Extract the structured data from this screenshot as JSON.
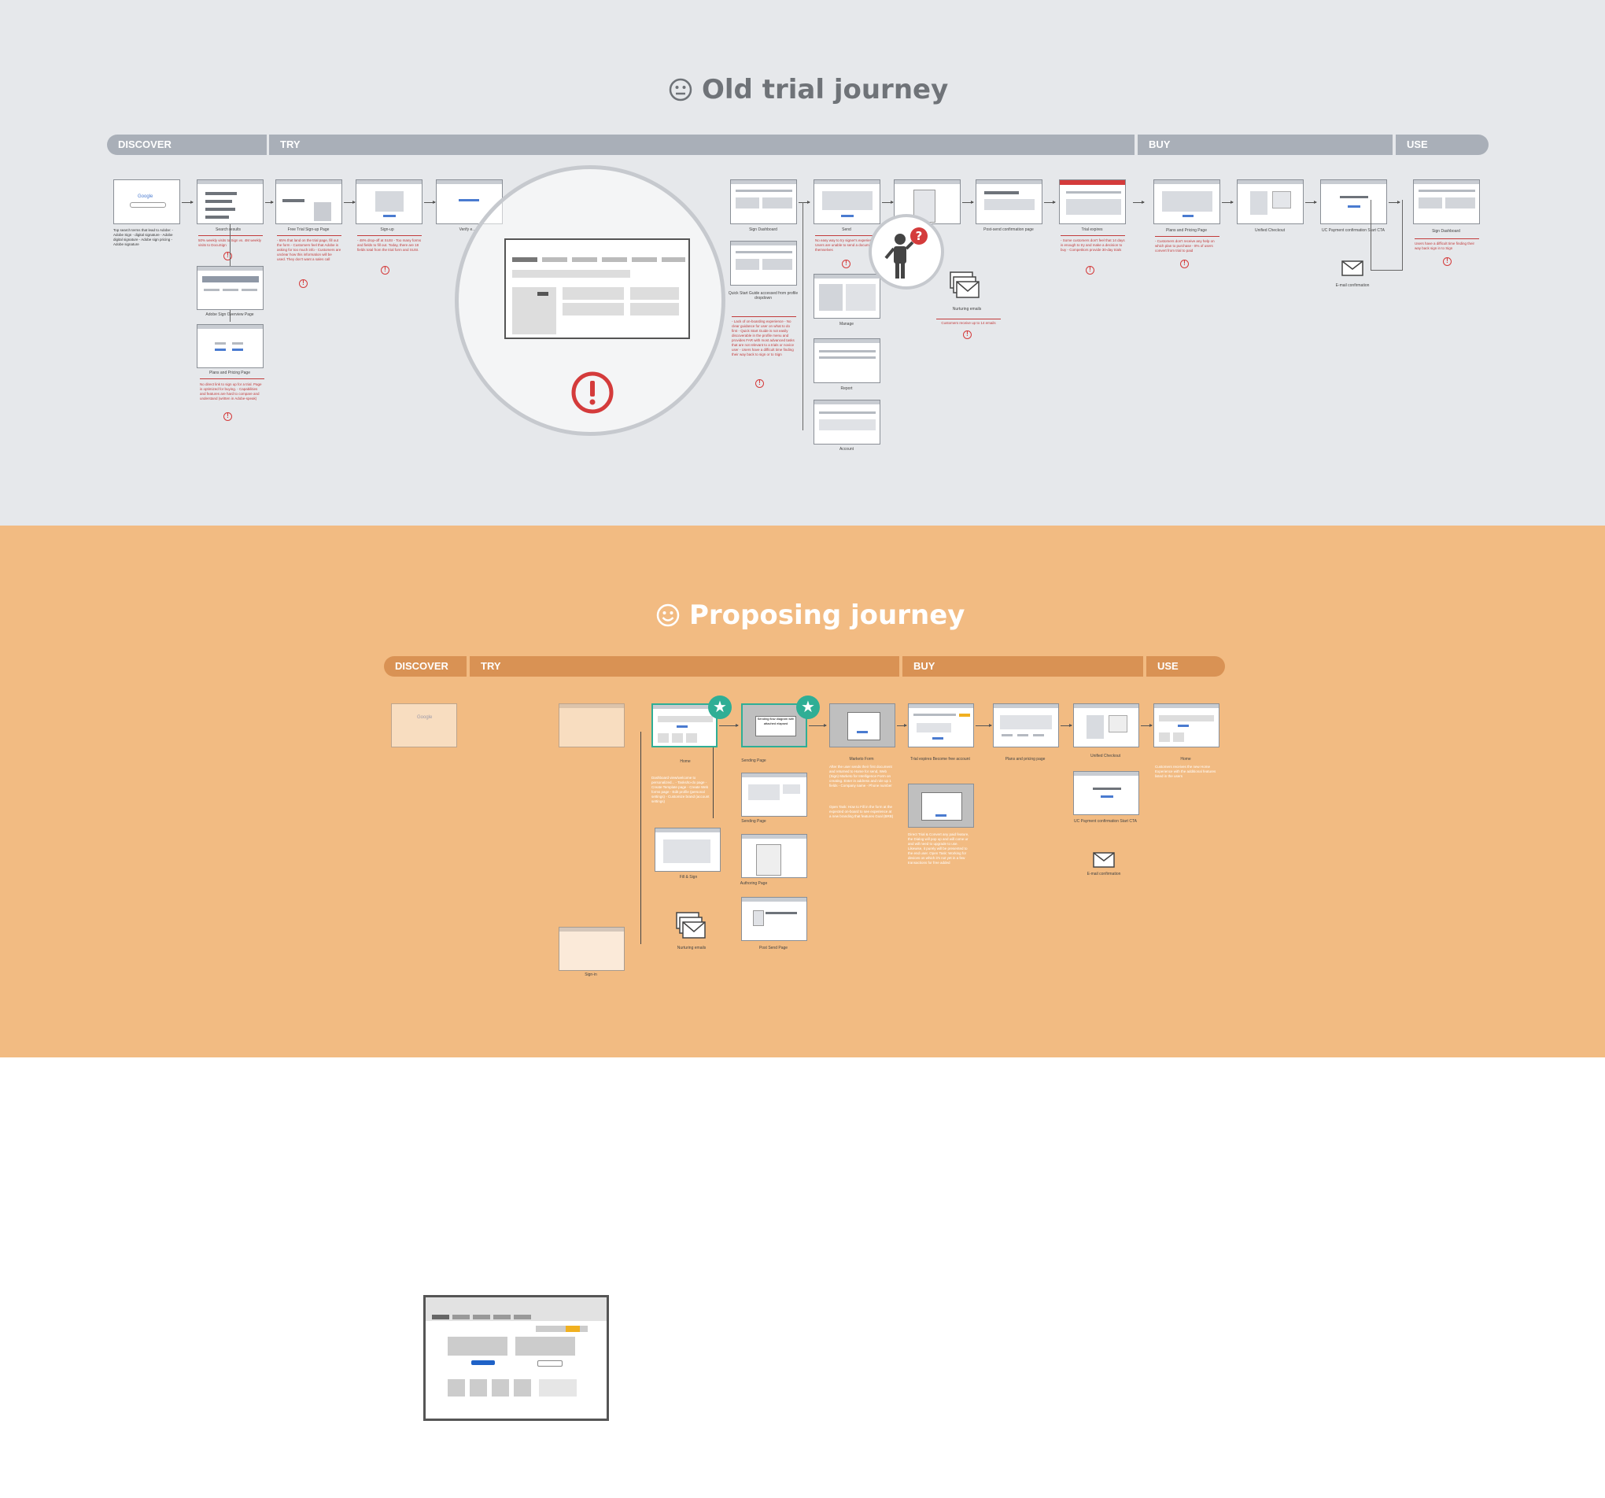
{
  "titles": {
    "old": "Old trial journey",
    "new": "Proposing journey"
  },
  "old_phases": [
    "DISCOVER",
    "TRY",
    "BUY",
    "USE"
  ],
  "new_phases": [
    "DISCOVER",
    "TRY",
    "BUY",
    "USE"
  ],
  "old_journey": {
    "labels": {
      "search": "Search results",
      "free_trial": "Free Trial Sign-up Page",
      "signup": "Sign-up",
      "verify": "Verify e...",
      "sign_dashboard": "Sign Dashboard",
      "send": "Send",
      "post_send": "Post-send confirmation page",
      "trial_expires": "Trial expires",
      "plans": "Plans and Pricing Page",
      "unified_checkout": "Unified Checkout",
      "payment": "UC Payment confirmation Start CTA",
      "dashboard_use": "Sign Dashboard",
      "overview": "Adobe Sign Overview Page",
      "plans_pricing": "Plans and Pricing Page",
      "quick_start": "Quick Start Guide accessed from profile dropdown",
      "manage": "Manage",
      "report": "Report",
      "account": "Account",
      "nurturing": "Nurturing emails",
      "email_confirm": "E-mail confirmation",
      "google": "Google"
    },
    "notes": {
      "search_terms": "Top search terms that lead to Adobe: - Adobe Sign - digital signature - Adobe digital signature - Adobe sign pricing - Adobe signature",
      "search": "50% weekly visits to Sign vs. 4M weekly visits to DocuSign",
      "free_trial": "- 65% that land on the trial page, fill out the form - Customers feel that Adobe is asking for too much info - Customers are unclear how this information will be used. They don't want a sales call",
      "signup": "- 48% drop-off at SUSI - Too many forms and fields to fill out. Today, there are 18 fields total from the trial form and SUSI.",
      "plans": "No direct link to sign up for a trial. Page is optimized for buying. - Capabilities and features are hard to compare and understand (written in Adobe-speak)",
      "quick_start": "- Lack of on-boarding experience - No clear guidance for user on what to do first - Quick Start Guide is not easily discoverable in the profile menu and provides FAR with most advanced tasks that are not relevant to a trials or novice user - Users have a difficult time finding their way back to sign or to Sign",
      "send": "No easy way to try signer's experience. Users are unable to send a document to themselves",
      "nurturing": "Customers receive up to 14 emails",
      "trial_expires": "- Some customers don't feel that 14 days is enough to try and make a decision to buy - Competitors provide 30-day trials",
      "plans_buy": "- Customers don't receive any help on which plan to purchase - 8% of users convert from trial to paid",
      "use": "Users have a difficult time finding their way back sign in to Sign"
    }
  },
  "new_journey": {
    "labels": {
      "home": "Home",
      "sending_page": "Sending Page",
      "sending_page2": "Sending Page",
      "fill_sign": "Fill & Sign",
      "authoring": "Authoring Page",
      "post_send": "Post Send Page",
      "marketo": "Marketo Form",
      "trial_expires": "Trial expires Become free account",
      "plans": "Plans and pricing page",
      "unified_checkout": "Unified Checkout",
      "payment": "UC Payment confirmation Start CTA",
      "email_confirm": "E-mail confirmation",
      "home_use": "Home",
      "nurturing": "Nurturing emails",
      "signin": "Sign-in",
      "sending_dialog": "Sending flow diagram with attached elapsed",
      "google": "Google"
    },
    "notes": {
      "home": "Dashboard view/welcome to personalized... - Tasks/to-do page - Create Template page - Create Web forms page - Edit profile (personal settings) - Customize brand (account settings)",
      "marketo": "After the user sends their first document and returned to Home for send, Web (Sign) Marketo for Intelligence Form on creating. Enter in address and role up 1 fields - Company name - Phone number",
      "marketo2": "Open Task: How to Fill in the form at the expected on-board to see experience at a new branding that features Goal (BRB)",
      "trial": "Direct Trial & Convert any paid feature, the Dialog will pop up and will come ur and will need to upgrade to use. Likewise, it purely will be presented to the end user. Open Task: Working for devices on which it's not yet in a few transactions for free added",
      "home_use": "Customers receives the new Home Experience with the additional features listed in the users"
    }
  }
}
